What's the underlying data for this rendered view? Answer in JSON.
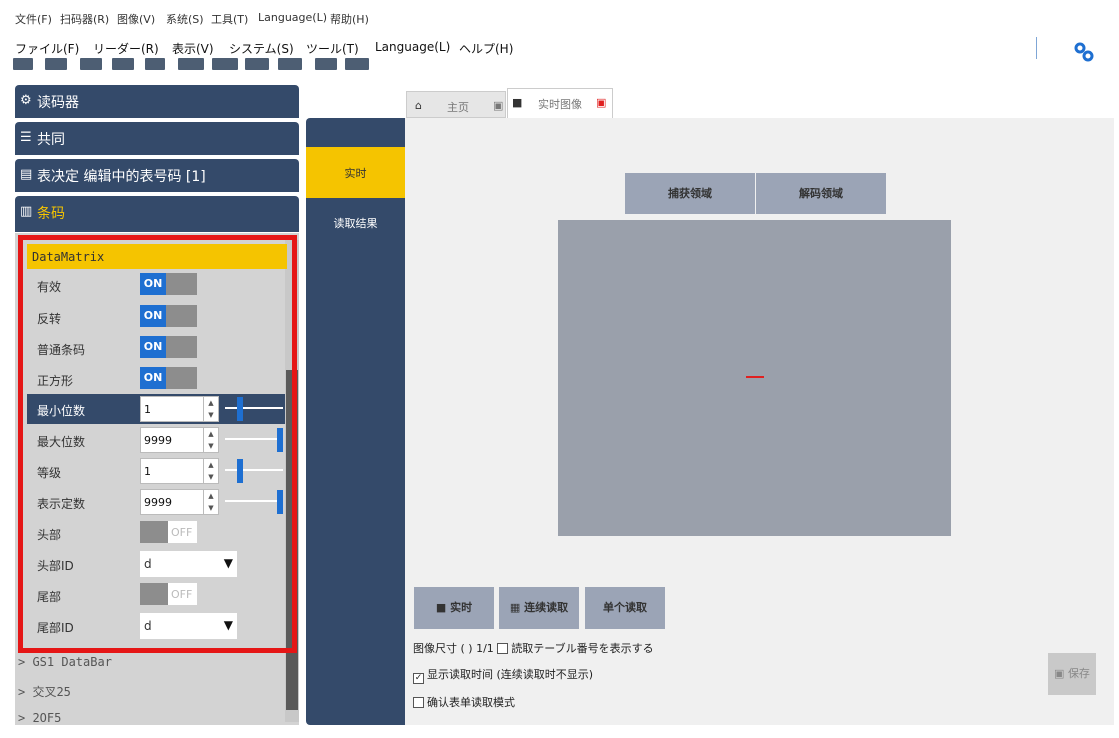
{
  "menu_native": [
    "文件(F)",
    "扫码器(R)",
    "图像(V)",
    "系统(S)",
    "工具(T)",
    "Language(L)",
    "帮助(H)"
  ],
  "menu_jp": [
    "ファイル(F)",
    "リーダー(R)",
    "表示(V)",
    "システム(S)",
    "ツール(T)",
    "Language(L)",
    "ヘルプ(H)"
  ],
  "sidebar": {
    "reader": "读码器",
    "common": "共同",
    "table_fixed": "表决定 编辑中的表号码 [1]",
    "barcode": "条码",
    "section": "DataMatrix",
    "params": {
      "valid": "有效",
      "invert": "反转",
      "mirror": "普通条码",
      "square": "正方形",
      "min_digits": "最小位数",
      "max_digits": "最大位数",
      "rank": "等级",
      "table_count": "表示定数",
      "head": "头部",
      "head_id": "头部ID",
      "tail": "尾部",
      "tail_id": "尾部ID"
    },
    "on": "ON",
    "off": "OFF",
    "values": {
      "min": "1",
      "max": "9999",
      "rank": "1",
      "count": "9999",
      "head_id": "d",
      "tail_id": "d"
    },
    "tree": [
      "> GS1 DataBar",
      "> 交叉25",
      "> 2OF5"
    ]
  },
  "tabs": {
    "home": "主页",
    "live": "实时图像"
  },
  "sidenav": {
    "live": "实时",
    "result": "读取结果"
  },
  "content": {
    "tab_capture": "捕获领域",
    "tab_decode": "解码领域",
    "btn_live": "实时",
    "btn_continuous": "连续读取",
    "btn_single": "单个读取",
    "img_size": "图像尺寸",
    "ratio": "1/1",
    "show_table": "読取テーブル番号を表示する",
    "show_time": "显示读取时间 (连续读取时不显示)",
    "confirm": "确认表单读取模式",
    "save": "保存"
  }
}
